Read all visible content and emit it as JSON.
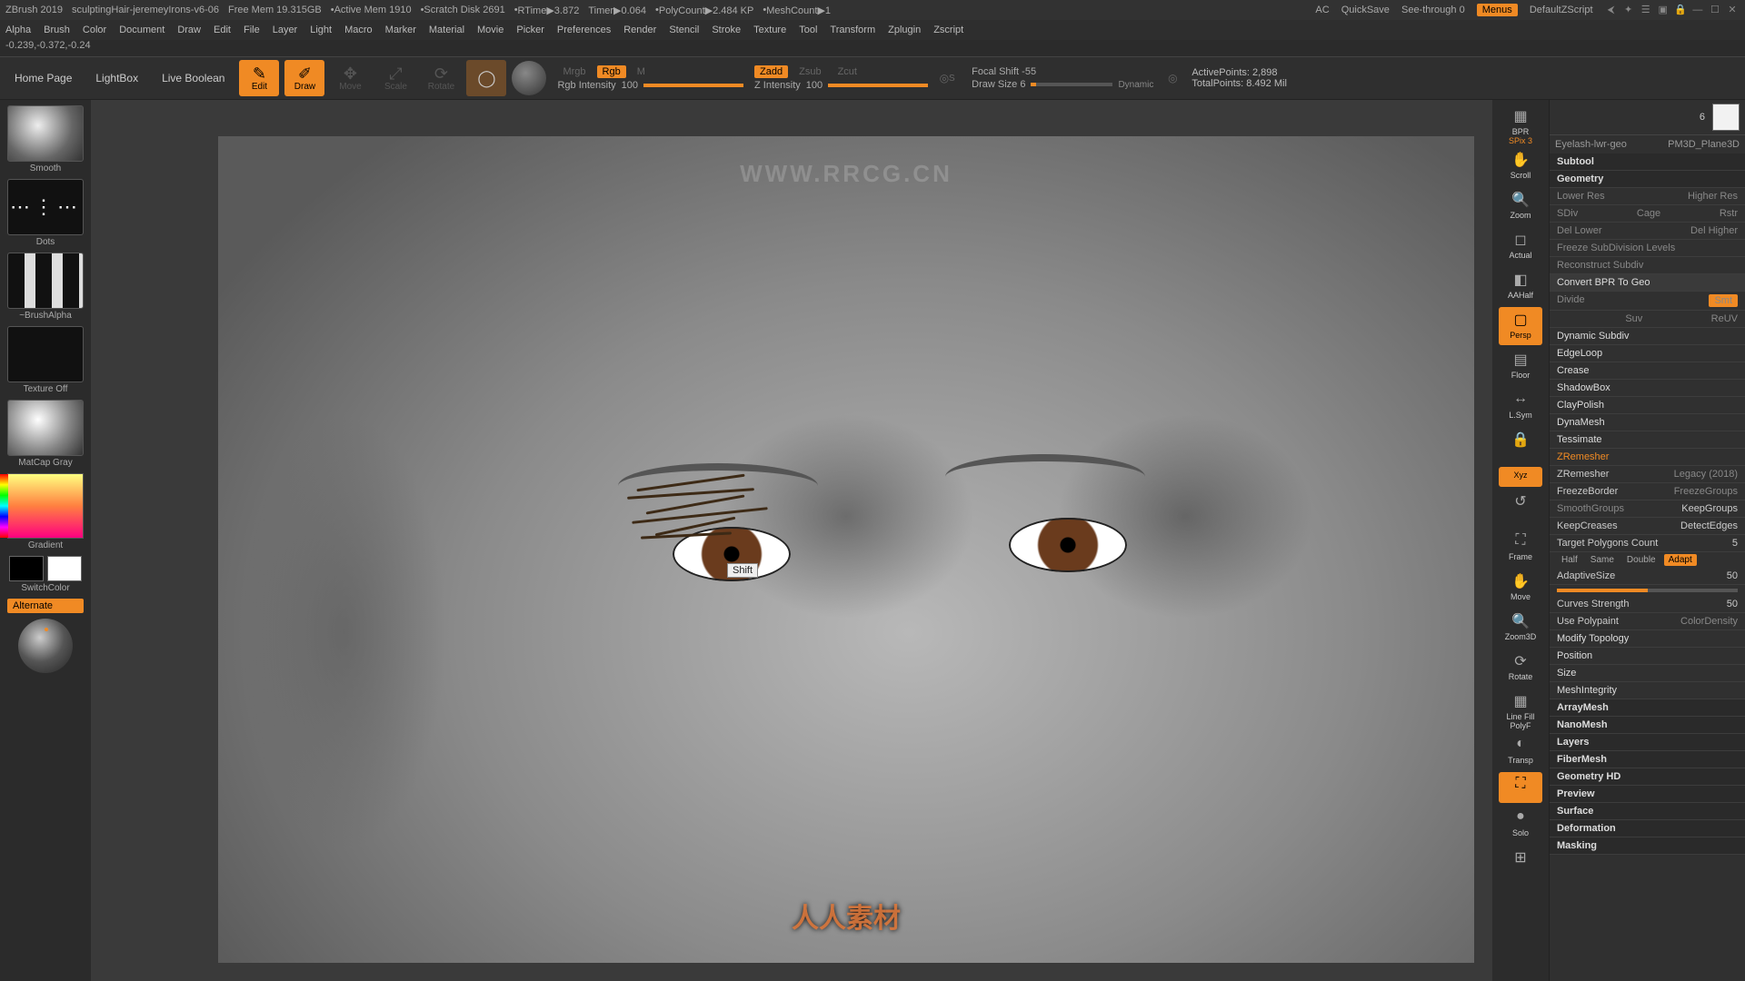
{
  "app": {
    "name": "ZBrush 2019",
    "document": "sculptingHair-jeremeyIrons-v6-06",
    "freeMem": "Free Mem 19.315GB",
    "activeMem": "Active Mem 1910",
    "scratch": "Scratch Disk 2691",
    "rtime": "RTime▶3.872",
    "timer": "Timer▶0.064",
    "polycount": "PolyCount▶2.484 KP",
    "meshcount": "MeshCount▶1",
    "ac": "AC",
    "quicksave": "QuickSave",
    "seethrough": "See-through  0",
    "menus": "Menus",
    "zscript": "DefaultZScript"
  },
  "menus": [
    "Alpha",
    "Brush",
    "Color",
    "Document",
    "Draw",
    "Edit",
    "File",
    "Layer",
    "Light",
    "Macro",
    "Marker",
    "Material",
    "Movie",
    "Picker",
    "Preferences",
    "Render",
    "Stencil",
    "Stroke",
    "Texture",
    "Tool",
    "Transform",
    "Zplugin",
    "Zscript"
  ],
  "coords": "-0.239,-0.372,-0.24",
  "toolbar": {
    "homepage": "Home Page",
    "lightbox": "LightBox",
    "liveboolean": "Live Boolean",
    "edit": "Edit",
    "draw": "Draw",
    "move": "Move",
    "scale": "Scale",
    "rotate": "Rotate",
    "mrgb": "Mrgb",
    "rgb": "Rgb",
    "m": "M",
    "rgbIntensityLabel": "Rgb Intensity",
    "rgbIntensityVal": "100",
    "zadd": "Zadd",
    "zsub": "Zsub",
    "zcut": "Zcut",
    "zIntensityLabel": "Z Intensity",
    "zIntensityVal": "100",
    "focalShift": "Focal Shift -55",
    "drawSize": "Draw Size 6",
    "dynamic": "Dynamic",
    "activePoints": "ActivePoints: 2,898",
    "totalPoints": "TotalPoints: 8.492 Mil"
  },
  "left": {
    "brush": "Smooth",
    "stroke": "Dots",
    "alpha": "~BrushAlpha",
    "texture": "Texture Off",
    "material": "MatCap Gray",
    "gradient": "Gradient",
    "switchcolor": "SwitchColor",
    "alternate": "Alternate"
  },
  "canvas": {
    "keyHint": "Shift",
    "watermark1": "WWW.RRCG.CN",
    "watermark2": "人人素材"
  },
  "vstrip": [
    {
      "id": "bpr",
      "label": "BPR",
      "sub": "SPix 3",
      "active": false
    },
    {
      "id": "scroll",
      "label": "Scroll"
    },
    {
      "id": "zoom",
      "label": "Zoom"
    },
    {
      "id": "actual",
      "label": "Actual"
    },
    {
      "id": "aahalf",
      "label": "AAHalf"
    },
    {
      "id": "persp",
      "label": "Persp",
      "active": true
    },
    {
      "id": "floor",
      "label": "Floor"
    },
    {
      "id": "lsym",
      "label": "L.Sym"
    },
    {
      "id": "localtransform",
      "label": ""
    },
    {
      "id": "xyz",
      "label": "Xyz",
      "active": true,
      "chip": true
    },
    {
      "id": "rotback",
      "label": ""
    },
    {
      "id": "frame",
      "label": "Frame"
    },
    {
      "id": "movehand",
      "label": "Move"
    },
    {
      "id": "zoom3d",
      "label": "Zoom3D"
    },
    {
      "id": "rotate3d",
      "label": "Rotate"
    },
    {
      "id": "linefill",
      "label": "Line Fill",
      "sub": "PolyF"
    },
    {
      "id": "transp",
      "label": "Transp"
    },
    {
      "id": "dynamic",
      "label": "",
      "active": true
    },
    {
      "id": "solo",
      "label": "Solo"
    },
    {
      "id": "xpose",
      "label": ""
    }
  ],
  "right": {
    "headNum": "6",
    "sub1": "Eyelash-lwr-geo",
    "sub2": "PM3D_Plane3D",
    "subtool": "Subtool",
    "geometry": "Geometry",
    "lowerRes": "Lower Res",
    "higherRes": "Higher Res",
    "sdiv": "SDiv",
    "cage": "Cage",
    "rstr": "Rstr",
    "delLower": "Del Lower",
    "delHigher": "Del Higher",
    "freezeSub": "Freeze SubDivision Levels",
    "reconstruct": "Reconstruct Subdiv",
    "convertBPR": "Convert BPR To Geo",
    "divide": "Divide",
    "smt": "Smt",
    "suv": "Suv",
    "reuv": "ReUV",
    "dynamicSubdiv": "Dynamic Subdiv",
    "edgeloop": "EdgeLoop",
    "crease": "Crease",
    "shadowbox": "ShadowBox",
    "claypolish": "ClayPolish",
    "dynamesh": "DynaMesh",
    "tessimate": "Tessimate",
    "zremesher": "ZRemesher",
    "zremesherBtn": "ZRemesher",
    "legacy": "Legacy (2018)",
    "freezeBorder": "FreezeBorder",
    "freezeGroups": "FreezeGroups",
    "smoothGroups": "SmoothGroups",
    "keepGroups": "KeepGroups",
    "keepCreases": "KeepCreases",
    "detectEdges": "DetectEdges",
    "targetPoly": "Target Polygons Count",
    "targetPolyVal": "5",
    "half": "Half",
    "same": "Same",
    "double": "Double",
    "adapt": "Adapt",
    "adaptiveSize": "AdaptiveSize",
    "adaptiveSizeVal": "50",
    "curvesStrength": "Curves Strength",
    "curvesStrengthVal": "50",
    "usePolypaint": "Use Polypaint",
    "colorDensity": "ColorDensity",
    "modifyTopo": "Modify Topology",
    "position": "Position",
    "size": "Size",
    "meshIntegrity": "MeshIntegrity",
    "arrayMesh": "ArrayMesh",
    "nanoMesh": "NanoMesh",
    "layers": "Layers",
    "fiberMesh": "FiberMesh",
    "geometryHD": "Geometry HD",
    "preview": "Preview",
    "surface": "Surface",
    "deformation": "Deformation",
    "masking": "Masking"
  }
}
